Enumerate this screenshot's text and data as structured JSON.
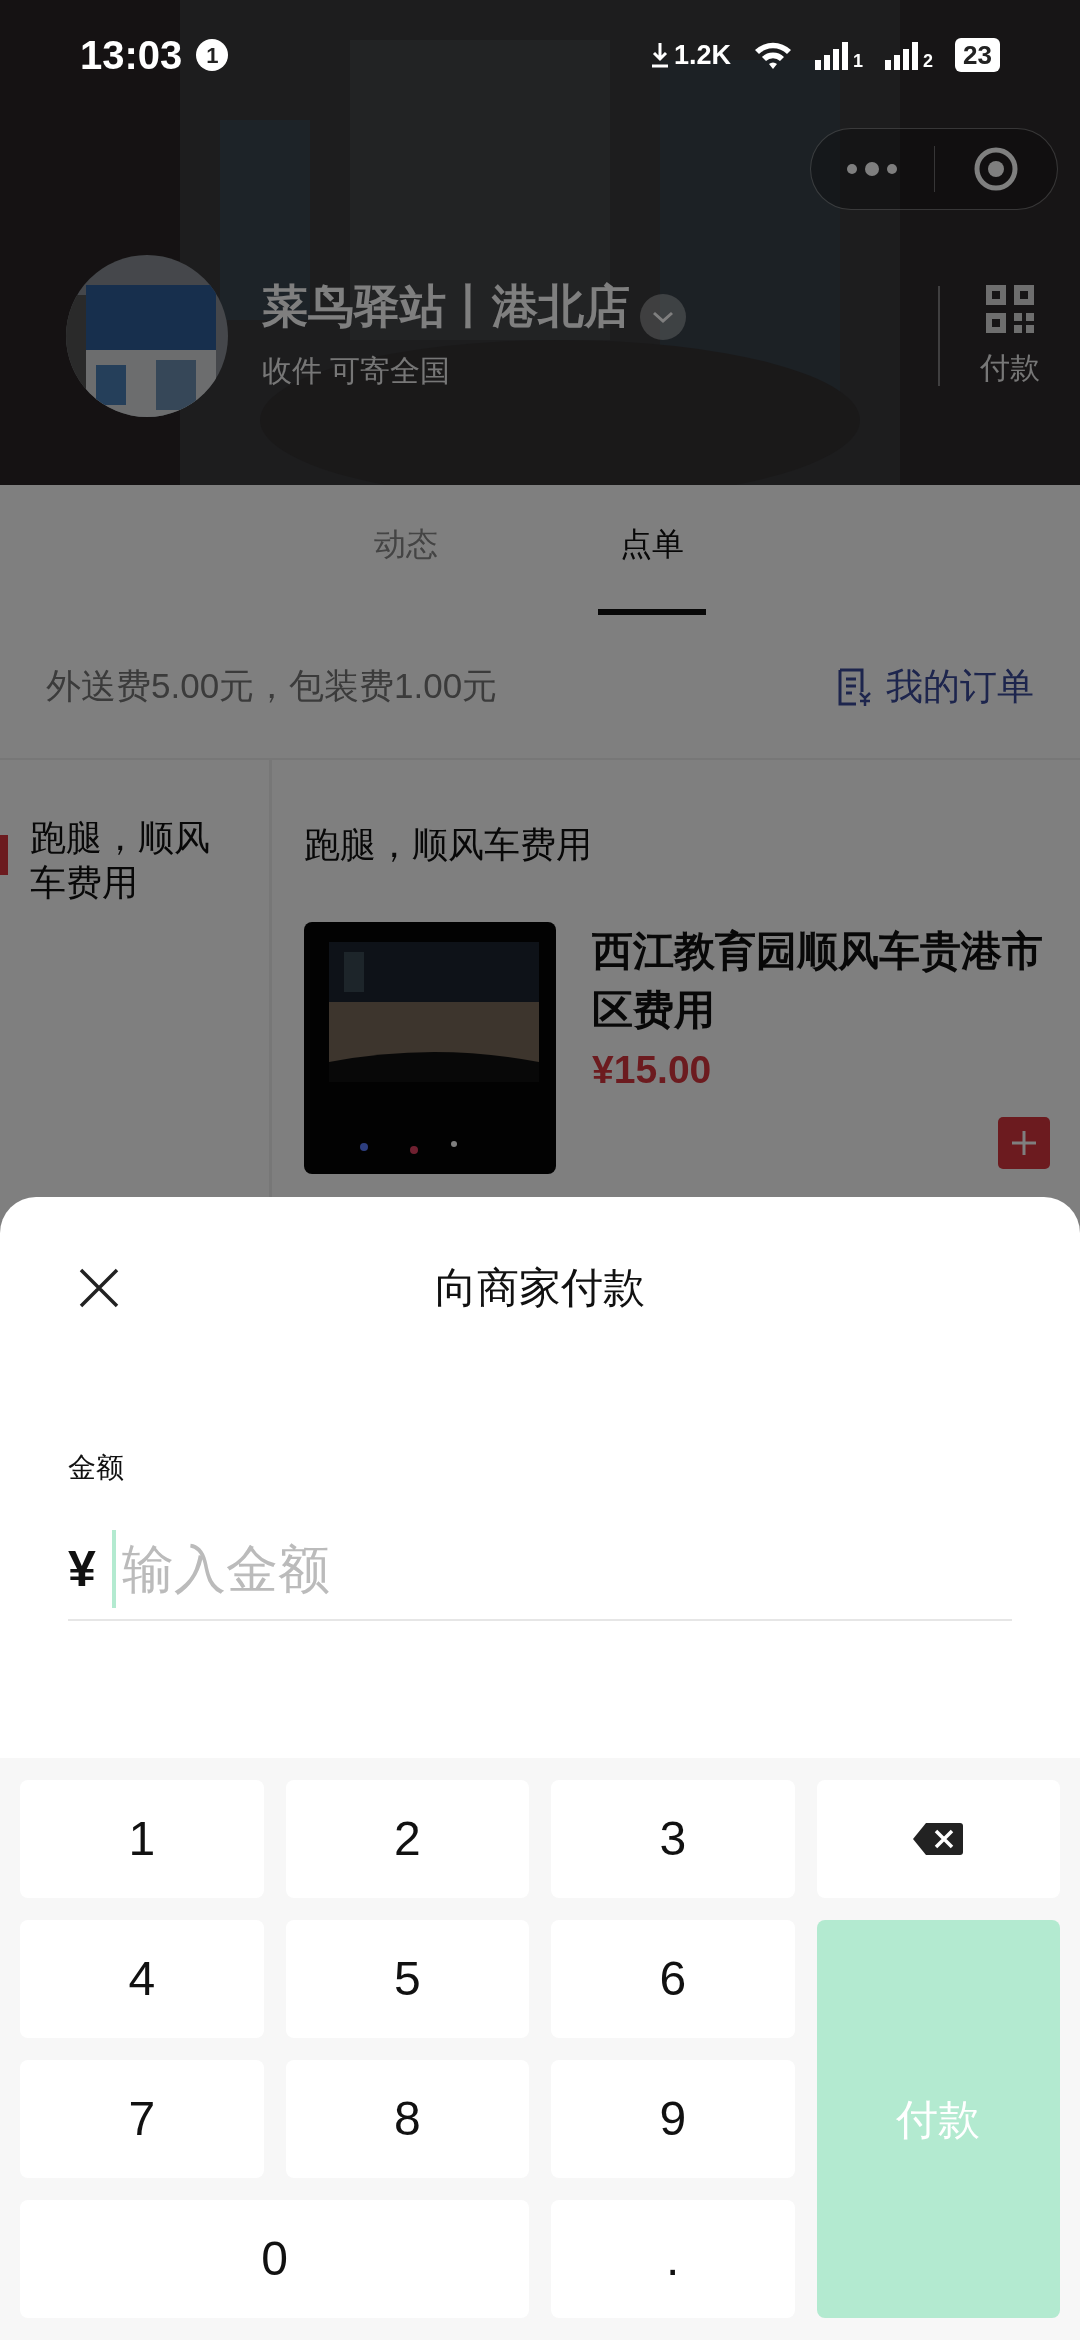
{
  "status_bar": {
    "time": "13:03",
    "notification_count": "1",
    "net_speed": "1.2K",
    "sims": [
      {
        "label": "1"
      },
      {
        "label": "2"
      }
    ],
    "battery": "23"
  },
  "store": {
    "name": "菜鸟驿站丨港北店",
    "subtitle": "收件 可寄全国",
    "pay_label": "付款"
  },
  "tabs": [
    {
      "label": "动态",
      "selected": false
    },
    {
      "label": "点单",
      "selected": true
    }
  ],
  "fee_note": "外送费5.00元，包装费1.00元",
  "my_orders": "我的订单",
  "categories": [
    {
      "label": "跑腿，顺风车费用",
      "selected": true
    }
  ],
  "section_title": "跑腿，顺风车费用",
  "products": [
    {
      "title": "西江教育园顺风车贵港市区费用",
      "price": "¥15.00"
    }
  ],
  "payment_sheet": {
    "title": "向商家付款",
    "amount_label": "金额",
    "currency": "¥",
    "placeholder": "输入金额"
  },
  "keypad": [
    {
      "kind": "digit",
      "label": "1"
    },
    {
      "kind": "digit",
      "label": "2"
    },
    {
      "kind": "digit",
      "label": "3"
    },
    {
      "kind": "backspace"
    },
    {
      "kind": "digit",
      "label": "4"
    },
    {
      "kind": "digit",
      "label": "5"
    },
    {
      "kind": "digit",
      "label": "6"
    },
    {
      "kind": "digit",
      "label": "7"
    },
    {
      "kind": "digit",
      "label": "8"
    },
    {
      "kind": "digit",
      "label": "9"
    },
    {
      "kind": "zero",
      "label": "0"
    },
    {
      "kind": "digit",
      "label": "."
    },
    {
      "kind": "pay",
      "label": "付款",
      "disabled": true
    }
  ]
}
